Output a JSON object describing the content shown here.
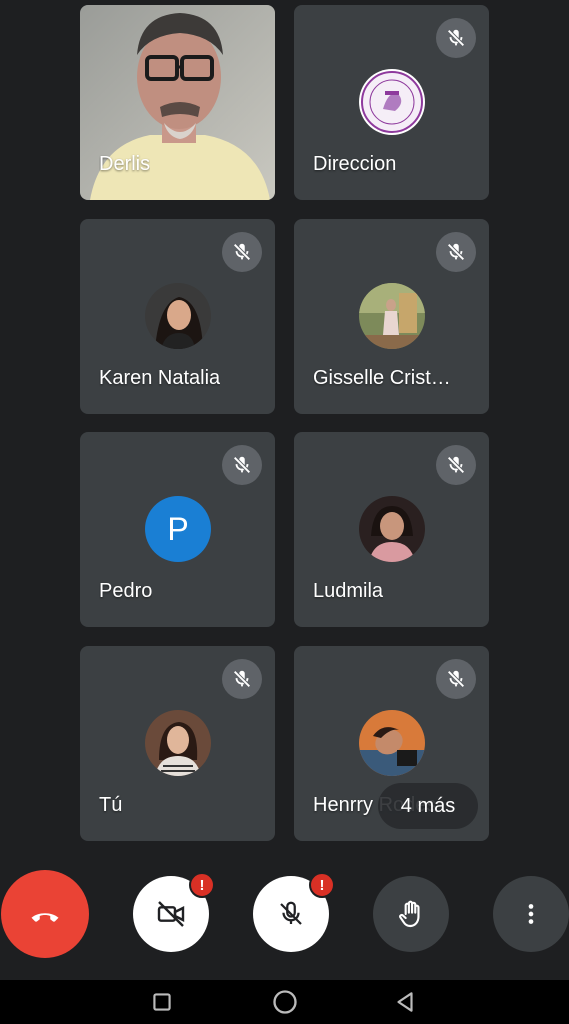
{
  "participants": [
    {
      "name": "Derlis",
      "muted": false,
      "avatar": "video"
    },
    {
      "name": "Direccion",
      "muted": true,
      "avatar": "school-seal"
    },
    {
      "name": "Karen Natalia",
      "muted": true,
      "avatar": "photo"
    },
    {
      "name": "Gisselle Crist…",
      "muted": true,
      "avatar": "photo"
    },
    {
      "name": "Pedro",
      "muted": true,
      "avatar": "P"
    },
    {
      "name": "Ludmila",
      "muted": true,
      "avatar": "photo"
    },
    {
      "name": "Tú",
      "muted": true,
      "avatar": "photo"
    },
    {
      "name": "Henrry Rodes",
      "muted": true,
      "avatar": "photo"
    }
  ],
  "more_participants_label": "4 más",
  "controls": {
    "end_call": {
      "icon": "hangup-icon",
      "color": "#ea4335"
    },
    "camera": {
      "icon": "camera-off-icon",
      "badge": "!"
    },
    "mic": {
      "icon": "mic-off-icon",
      "badge": "!"
    },
    "raise_hand": {
      "icon": "hand-icon"
    },
    "more": {
      "icon": "more-vert-icon"
    }
  },
  "navigation": [
    "recents-icon",
    "home-icon",
    "back-icon"
  ],
  "colors": {
    "background": "#1e1f21",
    "tile": "#3c4043",
    "end_call": "#ea4335",
    "badge": "#d93025",
    "avatar_p": "#1a7fd4"
  }
}
